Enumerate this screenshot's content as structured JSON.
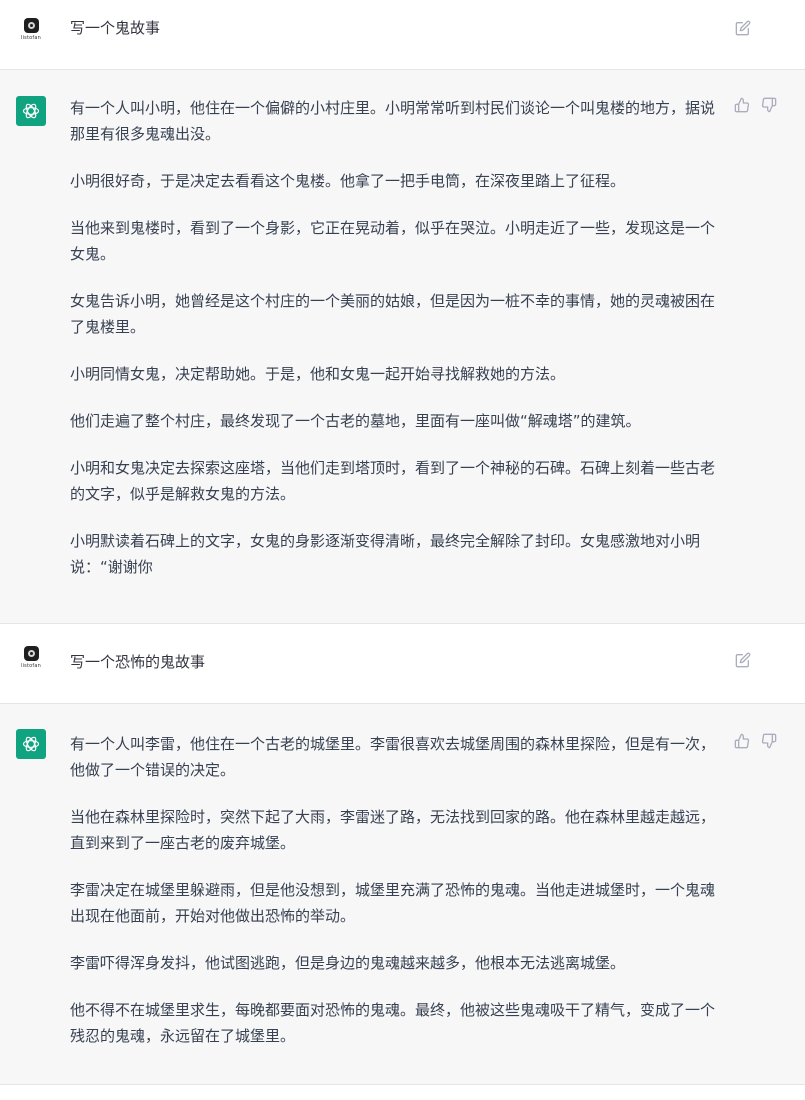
{
  "conversation": {
    "turns": [
      {
        "role": "user",
        "avatar_label": "listofan",
        "text": "写一个鬼故事"
      },
      {
        "role": "assistant",
        "paragraphs": [
          "有一个人叫小明，他住在一个偏僻的小村庄里。小明常常听到村民们谈论一个叫鬼楼的地方，据说那里有很多鬼魂出没。",
          "小明很好奇，于是决定去看看这个鬼楼。他拿了一把手电筒，在深夜里踏上了征程。",
          "当他来到鬼楼时，看到了一个身影，它正在晃动着，似乎在哭泣。小明走近了一些，发现这是一个女鬼。",
          "女鬼告诉小明，她曾经是这个村庄的一个美丽的姑娘，但是因为一桩不幸的事情，她的灵魂被困在了鬼楼里。",
          "小明同情女鬼，决定帮助她。于是，他和女鬼一起开始寻找解救她的方法。",
          "他们走遍了整个村庄，最终发现了一个古老的墓地，里面有一座叫做“解魂塔”的建筑。",
          "小明和女鬼决定去探索这座塔，当他们走到塔顶时，看到了一个神秘的石碑。石碑上刻着一些古老的文字，似乎是解救女鬼的方法。",
          "小明默读着石碑上的文字，女鬼的身影逐渐变得清晰，最终完全解除了封印。女鬼感激地对小明说：“谢谢你"
        ]
      },
      {
        "role": "user",
        "avatar_label": "listofan",
        "text": "写一个恐怖的鬼故事"
      },
      {
        "role": "assistant",
        "paragraphs": [
          "有一个人叫李雷，他住在一个古老的城堡里。李雷很喜欢去城堡周围的森林里探险，但是有一次，他做了一个错误的决定。",
          "当他在森林里探险时，突然下起了大雨，李雷迷了路，无法找到回家的路。他在森林里越走越远，直到来到了一座古老的废弃城堡。",
          "李雷决定在城堡里躲避雨，但是他没想到，城堡里充满了恐怖的鬼魂。当他走进城堡时，一个鬼魂出现在他面前，开始对他做出恐怖的举动。",
          "李雷吓得浑身发抖，他试图逃跑，但是身边的鬼魂越来越多，他根本无法逃离城堡。",
          "他不得不在城堡里求生，每晚都要面对恐怖的鬼魂。最终，他被这些鬼魂吸干了精气，变成了一个残忍的鬼魂，永远留在了城堡里。"
        ]
      }
    ]
  },
  "icons": {
    "edit": "edit-icon",
    "thumbs_up": "thumbs-up-icon",
    "thumbs_down": "thumbs-down-icon",
    "assistant_logo": "openai-logo-icon"
  },
  "colors": {
    "assistant_avatar": "#10a37f",
    "assistant_bg": "#f7f7f8",
    "user_bg": "#ffffff",
    "text": "#374151",
    "icon": "#acacbe"
  }
}
